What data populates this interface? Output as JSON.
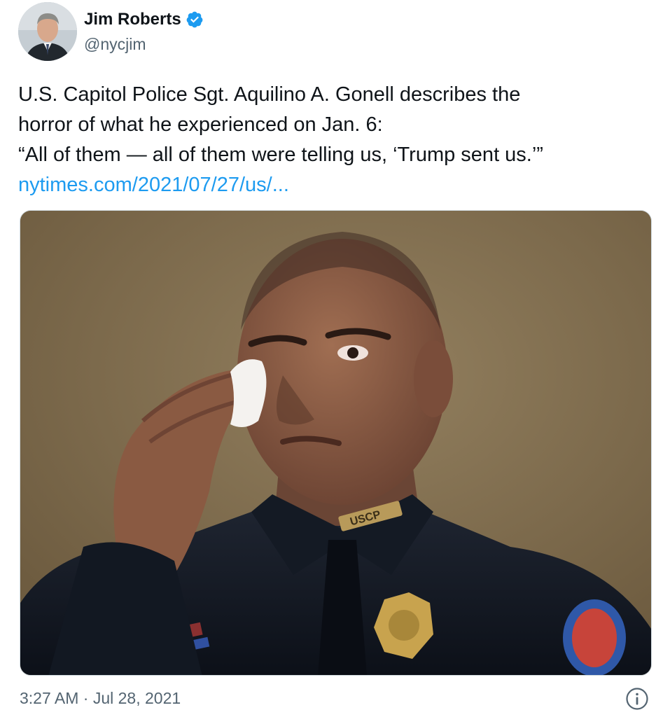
{
  "author": {
    "display_name": "Jim Roberts",
    "handle": "@nycjim",
    "verified": true
  },
  "tweet": {
    "lines": [
      "U.S. Capitol Police Sgt. Aquilino A. Gonell describes the",
      "horror of what he experienced on Jan. 6:",
      "“All of them — all of them were telling us, ‘Trump sent us.’”"
    ],
    "link_text": "nytimes.com/2021/07/27/us/..."
  },
  "photo": {
    "badge_text": "USCP"
  },
  "footer": {
    "timestamp": "3:27 AM · Jul 28, 2021"
  },
  "icons": {
    "verified": "verified-badge-icon",
    "info": "info-icon"
  },
  "colors": {
    "link": "#1d9bf0",
    "secondary_text": "#536471",
    "verified": "#1d9bf0"
  }
}
